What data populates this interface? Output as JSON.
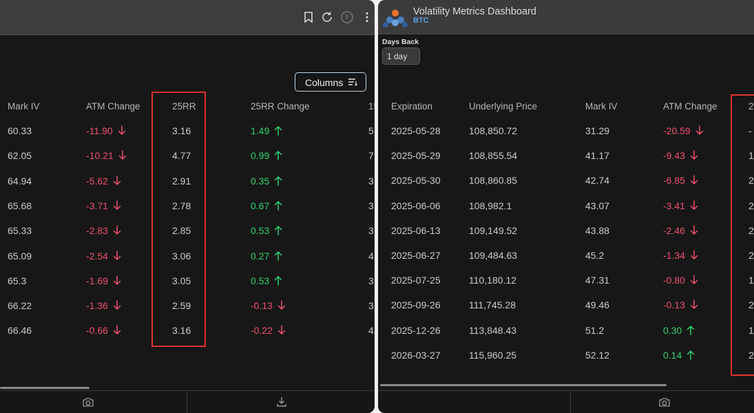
{
  "left_panel": {
    "toolbar": {
      "icons": [
        "bookmark-icon",
        "refresh-icon",
        "info-icon",
        "more-vertical-icon"
      ]
    },
    "columns_button": {
      "label": "Columns",
      "icon": "sort-lines-icon"
    },
    "headers": [
      "Mark IV",
      "ATM Change",
      "25RR",
      "25RR Change",
      "15"
    ],
    "rows": [
      {
        "mark_iv": "60.33",
        "atm_change": "-11.90",
        "rr25": "3.16",
        "rr25_change": "1.49",
        "col5": "5."
      },
      {
        "mark_iv": "62.05",
        "atm_change": "-10.21",
        "rr25": "4.77",
        "rr25_change": "0.99",
        "col5": "7."
      },
      {
        "mark_iv": "64.94",
        "atm_change": "-5.62",
        "rr25": "2.91",
        "rr25_change": "0.35",
        "col5": "3."
      },
      {
        "mark_iv": "65.68",
        "atm_change": "-3.71",
        "rr25": "2.78",
        "rr25_change": "0.67",
        "col5": "3."
      },
      {
        "mark_iv": "65.33",
        "atm_change": "-2.83",
        "rr25": "2.85",
        "rr25_change": "0.53",
        "col5": "3."
      },
      {
        "mark_iv": "65.09",
        "atm_change": "-2.54",
        "rr25": "3.06",
        "rr25_change": "0.27",
        "col5": "4."
      },
      {
        "mark_iv": "65.3",
        "atm_change": "-1.69",
        "rr25": "3.05",
        "rr25_change": "0.53",
        "col5": "3."
      },
      {
        "mark_iv": "66.22",
        "atm_change": "-1.36",
        "rr25": "2.59",
        "rr25_change": "-0.13",
        "col5": "3."
      },
      {
        "mark_iv": "66.46",
        "atm_change": "-0.66",
        "rr25": "3.16",
        "rr25_change": "-0.22",
        "col5": "4."
      }
    ],
    "footer_icons": [
      "camera-icon",
      "download-icon"
    ]
  },
  "right_panel": {
    "title": "Volatility Metrics Dashboard",
    "subtitle": "BTC",
    "days_back": {
      "label": "Days Back",
      "value": "1 day"
    },
    "headers": [
      "Expiration",
      "Underlying Price",
      "Mark IV",
      "ATM Change",
      "2"
    ],
    "rows": [
      {
        "expiration": "2025-05-28",
        "underlying": "108,850.72",
        "mark_iv": "31.29",
        "atm_change": "-20.59",
        "col5": "-"
      },
      {
        "expiration": "2025-05-29",
        "underlying": "108,855.54",
        "mark_iv": "41.17",
        "atm_change": "-9.43",
        "col5": "1"
      },
      {
        "expiration": "2025-05-30",
        "underlying": "108,860.85",
        "mark_iv": "42.74",
        "atm_change": "-6.85",
        "col5": "2"
      },
      {
        "expiration": "2025-06-06",
        "underlying": "108,982.1",
        "mark_iv": "43.07",
        "atm_change": "-3.41",
        "col5": "2"
      },
      {
        "expiration": "2025-06-13",
        "underlying": "109,149.52",
        "mark_iv": "43.88",
        "atm_change": "-2.46",
        "col5": "2"
      },
      {
        "expiration": "2025-06-27",
        "underlying": "109,484.63",
        "mark_iv": "45.2",
        "atm_change": "-1.34",
        "col5": "2"
      },
      {
        "expiration": "2025-07-25",
        "underlying": "110,180.12",
        "mark_iv": "47.31",
        "atm_change": "-0.80",
        "col5": "1"
      },
      {
        "expiration": "2025-09-26",
        "underlying": "111,745.28",
        "mark_iv": "49.46",
        "atm_change": "-0.13",
        "col5": "2"
      },
      {
        "expiration": "2025-12-26",
        "underlying": "113,848.43",
        "mark_iv": "51.2",
        "atm_change": "0.30",
        "col5": "1"
      },
      {
        "expiration": "2026-03-27",
        "underlying": "115,960.25",
        "mark_iv": "52.12",
        "atm_change": "0.14",
        "col5": "2"
      }
    ],
    "footer_icons": [
      "camera-icon"
    ]
  },
  "colors": {
    "negative": "#f0506d",
    "positive": "#2fd36f",
    "highlight_box": "#e0322a",
    "subtitle": "#5aa0e6"
  }
}
